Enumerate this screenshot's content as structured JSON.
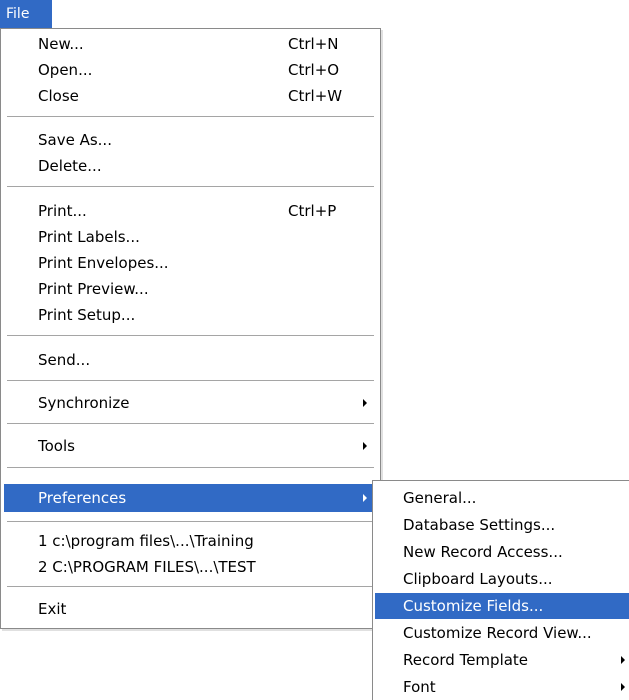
{
  "menubar": {
    "file_label": "File"
  },
  "file_menu": {
    "new": "New...",
    "new_shortcut": "Ctrl+N",
    "open": "Open...",
    "open_shortcut": "Ctrl+O",
    "close": "Close",
    "close_shortcut": "Ctrl+W",
    "save_as": "Save As...",
    "delete": "Delete...",
    "print": "Print...",
    "print_shortcut": "Ctrl+P",
    "print_labels": "Print Labels...",
    "print_envelopes": "Print Envelopes...",
    "print_preview": "Print Preview...",
    "print_setup": "Print Setup...",
    "send": "Send...",
    "synchronize": "Synchronize",
    "tools": "Tools",
    "preferences": "Preferences",
    "recent_1": "1 c:\\program files\\...\\Training",
    "recent_2": "2 C:\\PROGRAM FILES\\...\\TEST",
    "exit": "Exit"
  },
  "preferences_menu": {
    "general": "General...",
    "database_settings": "Database Settings...",
    "new_record_access": "New Record Access...",
    "clipboard_layouts": "Clipboard Layouts...",
    "customize_fields": "Customize Fields...",
    "customize_record_view": "Customize Record View...",
    "record_template": "Record Template",
    "font": "Font"
  },
  "colors": {
    "highlight": "#316ac5",
    "highlight_text": "#ffffff",
    "separator": "#a5a5a5"
  },
  "icons": {
    "submenu": "triangle-right-icon"
  }
}
